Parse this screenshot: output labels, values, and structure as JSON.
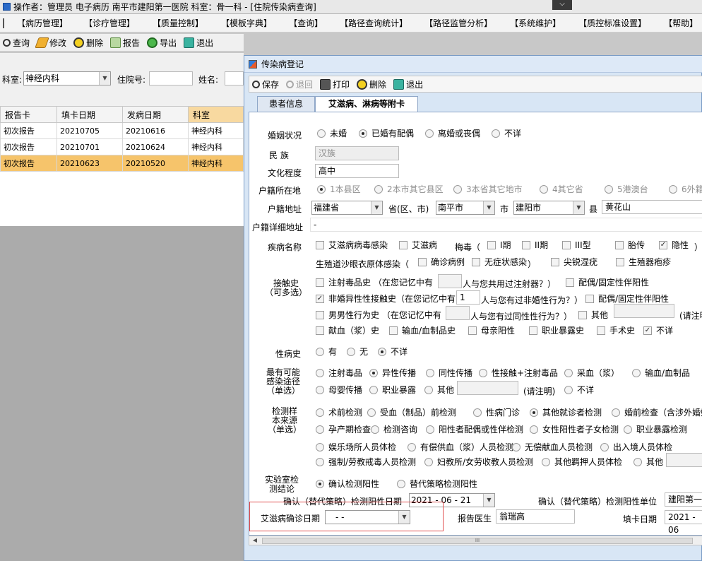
{
  "window": {
    "title": "操作者：管理员 电子病历  南平市建阳第一医院  科室：骨一科 - [住院传染病查询]",
    "close_glyph": "⌵"
  },
  "menu": [
    "【病历管理】",
    "【诊疗管理】",
    "【质量控制】",
    "【模板字典】",
    "【查询】",
    "【路径查询统计】",
    "【路径监管分析】",
    "【系统维护】",
    "【质控标准设置】",
    "【帮助】",
    "【纷"
  ],
  "toolbar": {
    "query": "查询",
    "edit": "修改",
    "delete": "删除",
    "report": "报告",
    "export": "导出",
    "exit": "退出"
  },
  "filter": {
    "dept_label": "科室:",
    "dept_value": "神经内科",
    "inpatient_label": "住院号:",
    "name_label": "姓名:"
  },
  "grid": {
    "columns": [
      "报告卡",
      "填卡日期",
      "发病日期",
      "科室"
    ],
    "rows": [
      [
        "初次报告",
        "20210705",
        "20210616",
        "神经内科"
      ],
      [
        "初次报告",
        "20210701",
        "20210624",
        "神经内科"
      ],
      [
        "初次报告",
        "20210623",
        "20210520",
        "神经内科"
      ]
    ]
  },
  "dialog": {
    "title": "传染病登记",
    "toolbar": {
      "save": "保存",
      "back": "退回",
      "print": "打印",
      "delete": "删除",
      "exit": "退出"
    },
    "tabs": [
      "患者信息",
      "艾滋病、淋病等附卡"
    ],
    "form": {
      "marital_label": "婚姻状况",
      "marital_opts": [
        "未婚",
        "已婚有配偶",
        "离婚或丧偶",
        "不详"
      ],
      "ethnic_label": "民    族",
      "ethnic_value": "汉族",
      "edu_label": "文化程度",
      "edu_value": "高中",
      "hukou_label": "户籍所在地",
      "hukou_opts": [
        "1本县区",
        "2本市其它县区",
        "3本省其它地市",
        "4其它省",
        "5港澳台",
        "6外籍"
      ],
      "hukou_addr_label": "户籍地址",
      "province": "福建省",
      "province_label": "省(区、市)",
      "city": "南平市",
      "city_label": "市",
      "county": "建阳市",
      "county_label": "县",
      "town": "黄花山",
      "hukou_detail_label": "户籍详细地址",
      "hukou_detail_value": "-",
      "disease_label": "疾病名称",
      "disease_opts": [
        "艾滋病病毒感染",
        "艾滋病",
        "I期",
        "II期",
        "III型",
        "胎传",
        "隐性"
      ],
      "syphilis_prefix": "梅毒（",
      "syphilis_suffix": "）",
      "disease_row2_label": "生殖道沙眼衣原体感染（",
      "disease_row2_opts": [
        "确诊病例",
        "无症状感染",
        "尖锐湿疣",
        "生殖器疱疹"
      ],
      "disease_row2_close": "）",
      "contact_label_1": "接触史",
      "contact_label_2": "（可多选）",
      "contact_r1_a": "注射毒品史 （在您记忆中有",
      "contact_r1_b": "人与您共用过注射器？）",
      "contact_r1_c": "配偶/固定性伴阳性",
      "contact_r2_a": "非婚异性性接触史（在您记忆中有",
      "contact_r2_val": "1",
      "contact_r2_b": "人与您有过非婚性行为？）",
      "contact_r2_c": "配偶/固定性伴阳性",
      "contact_r3_a": "男男性行为史 （在您记忆中有",
      "contact_r3_b": "人与您有过同性性行为？）",
      "contact_r3_c": "其他",
      "contact_r3_d": "(请注明",
      "contact_r4": [
        "献血（浆）史",
        "输血/血制品史",
        "母亲阳性",
        "职业暴露史",
        "手术史",
        "不详"
      ],
      "std_hist_label": "性病史",
      "std_hist_opts": [
        "有",
        "无",
        "不详"
      ],
      "route_label_1": "最有可能",
      "route_label_2": "感染途径",
      "route_label_3": "（单选）",
      "route_r1": [
        "注射毒品",
        "异性传播",
        "同性传播",
        "性接触+注射毒品",
        "采血（浆）",
        "输血/血制品"
      ],
      "route_r2": [
        "母婴传播",
        "职业暴露",
        "其他"
      ],
      "route_r2_note": "(请注明)",
      "route_r2_last": "不详",
      "sample_label_1": "检测样",
      "sample_label_2": "本来源",
      "sample_label_3": "（单选）",
      "sample_r1": [
        "术前检测",
        "受血（制品）前检测",
        "性病门诊",
        "其他就诊者检测",
        "婚前检查（含涉外婚姻）"
      ],
      "sample_r2": [
        "孕产期检查",
        "检测咨询",
        "阳性者配偶或性伴检测",
        "女性阳性者子女检测",
        "职业暴露检测"
      ],
      "sample_r3": [
        "娱乐场所人员体检",
        "有偿供血（浆）人员检测",
        "无偿献血人员检测",
        "出入境人员体检"
      ],
      "sample_r4": [
        "强制/劳教戒毒人员检测",
        "妇教所/女劳收教人员检测",
        "其他羁押人员体检",
        "其他"
      ],
      "lab_label_1": "实验室检",
      "lab_label_2": "测结论",
      "lab_opts": [
        "确认检测阳性",
        "替代策略检测阳性"
      ],
      "confirm_date_label": "确认（替代策略）检测阳性日期",
      "confirm_date_value": "2021 - 06 - 21",
      "confirm_unit_label": "确认（替代策略）检测阳性单位",
      "confirm_unit_value": "建阳第一",
      "aids_date_label": "艾滋病确诊日期",
      "aids_date_value": "-    -",
      "doctor_label": "报告医生",
      "doctor_value": "翁瑞高",
      "fill_date_label": "填卡日期",
      "fill_date_value": "2021 - 06"
    }
  },
  "scroll_mark": "III",
  "colors": {
    "dialog_bg": "#d8e6f5",
    "highlight_row": "#f6c46b",
    "selected_header": "#f8d9a0",
    "annotation_box": "#e05050"
  }
}
